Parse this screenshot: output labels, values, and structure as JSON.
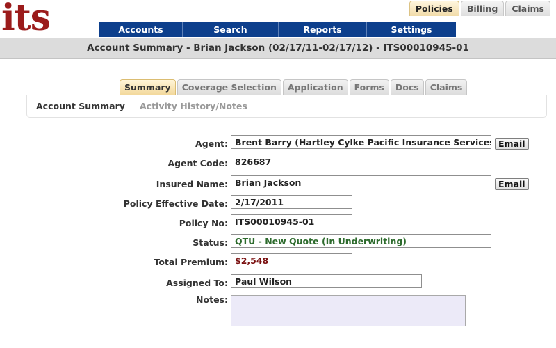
{
  "brand": {
    "logo_text": "its",
    "color": "#9b1b1b"
  },
  "top_tabs": [
    {
      "label": "Policies",
      "active": true
    },
    {
      "label": "Billing",
      "active": false
    },
    {
      "label": "Claims",
      "active": false
    }
  ],
  "main_nav": [
    {
      "label": "Accounts"
    },
    {
      "label": "Search"
    },
    {
      "label": "Reports"
    },
    {
      "label": "Settings"
    }
  ],
  "summary_title": "Account Summary - Brian Jackson (02/17/11-02/17/12) - ITS00010945-01",
  "sub_tabs": [
    {
      "label": "Summary",
      "active": true
    },
    {
      "label": "Coverage Selection",
      "active": false
    },
    {
      "label": "Application",
      "active": false
    },
    {
      "label": "Forms",
      "active": false
    },
    {
      "label": "Docs",
      "active": false
    },
    {
      "label": "Claims",
      "active": false
    }
  ],
  "sections": {
    "active": "Account Summary",
    "inactive": "Activity History/Notes"
  },
  "form": {
    "agent": {
      "label": "Agent:",
      "value": "Brent Barry (Hartley Cylke Pacific Insurance Services, Inc.)"
    },
    "agent_code": {
      "label": "Agent Code:",
      "value": "826687"
    },
    "insured_name": {
      "label": "Insured Name:",
      "value": "Brian Jackson"
    },
    "effective_date": {
      "label": "Policy Effective Date:",
      "value": "2/17/2011"
    },
    "policy_no": {
      "label": "Policy No:",
      "value": "ITS00010945-01"
    },
    "status": {
      "label": "Status:",
      "value": "QTU - New Quote (In Underwriting)",
      "color": "#2d6b2d"
    },
    "total_premium": {
      "label": "Total Premium:",
      "value": "$2,548",
      "color": "#7a1010"
    },
    "assigned_to": {
      "label": "Assigned To:",
      "value": "Paul Wilson"
    },
    "notes": {
      "label": "Notes:",
      "value": ""
    }
  },
  "email_label": "Email",
  "colors": {
    "nav": "#0d3f8c",
    "active_tab": "#f2d799",
    "notes_bg": "#eceaf8"
  }
}
